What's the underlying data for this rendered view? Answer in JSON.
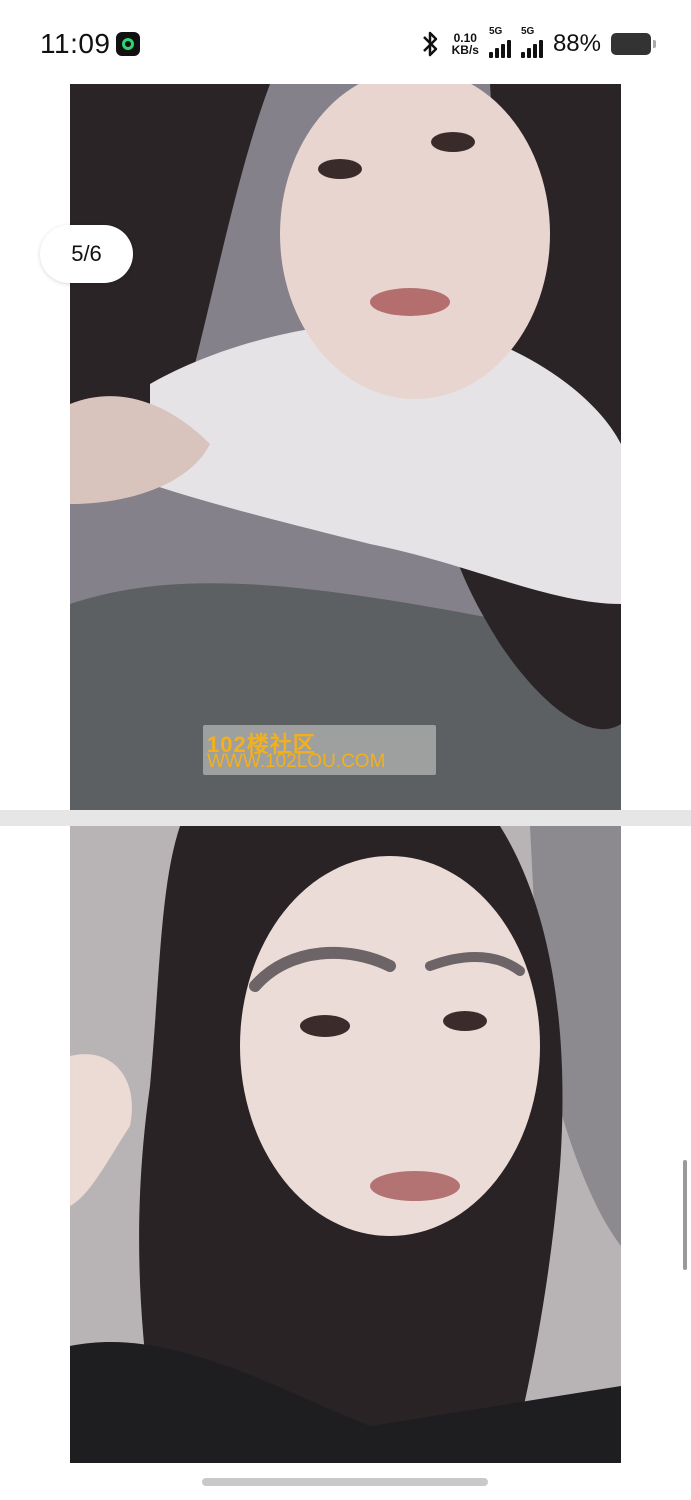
{
  "status_bar": {
    "time": "11:09",
    "net_speed_value": "0.10",
    "net_speed_unit": "KB/s",
    "sim1_label": "5G",
    "sim2_label": "5G",
    "battery_percent": "88%"
  },
  "viewer": {
    "page_indicator": "5/6"
  },
  "watermark": {
    "line1": "102楼社区",
    "line2": "WWW.102LOU.COM"
  }
}
